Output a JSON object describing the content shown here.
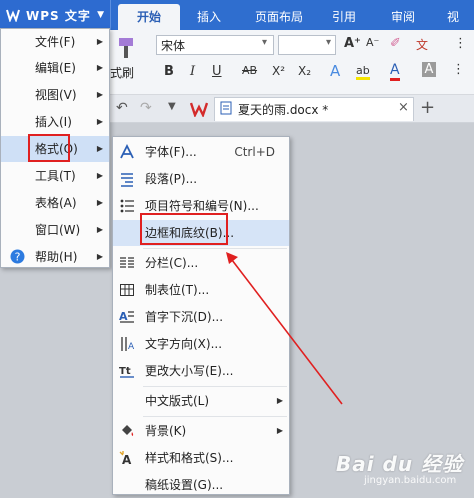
{
  "app": {
    "title": "WPS 文字",
    "ribbon_tabs": [
      "开始",
      "插入",
      "页面布局",
      "引用",
      "审阅",
      "视"
    ]
  },
  "ribbon": {
    "format_painter_label": "式刷",
    "font_name": "宋体",
    "buttons": {
      "bold": "B",
      "italic": "I",
      "underline": "U",
      "strikethrough": "AB",
      "superscript": "X²",
      "subscript": "X₂",
      "text_effect": "A",
      "highlight": "ab",
      "font_color": "A",
      "char_shading": "A",
      "grow_font": "A⁺",
      "shrink_font": "A⁻",
      "pinyin": "文"
    }
  },
  "document_tab": {
    "name": "夏天的雨.docx *",
    "close": "×",
    "add": "+"
  },
  "main_menu": {
    "items": [
      {
        "label": "文件(F)"
      },
      {
        "label": "编辑(E)"
      },
      {
        "label": "视图(V)"
      },
      {
        "label": "插入(I)"
      },
      {
        "label": "格式(O)"
      },
      {
        "label": "工具(T)"
      },
      {
        "label": "表格(A)"
      },
      {
        "label": "窗口(W)"
      },
      {
        "label": "帮助(H)"
      }
    ]
  },
  "format_menu": {
    "items": [
      {
        "label": "字体(F)...",
        "shortcut": "Ctrl+D",
        "icon": "font-A-icon"
      },
      {
        "label": "段落(P)...",
        "icon": "paragraph-icon"
      },
      {
        "label": "项目符号和编号(N)...",
        "icon": "bullet-list-icon"
      },
      {
        "label": "边框和底纹(B)...",
        "icon": ""
      },
      {
        "label": "分栏(C)...",
        "icon": "columns-icon"
      },
      {
        "label": "制表位(T)...",
        "icon": "tab-stop-icon"
      },
      {
        "label": "首字下沉(D)...",
        "icon": "drop-cap-icon"
      },
      {
        "label": "文字方向(X)...",
        "icon": "text-direction-icon"
      },
      {
        "label": "更改大小写(E)...",
        "icon": "change-case-icon"
      },
      {
        "label": "中文版式(L)",
        "icon": ""
      },
      {
        "label": "背景(K)",
        "icon": "paint-bucket-icon"
      },
      {
        "label": "样式和格式(S)...",
        "icon": "styles-icon"
      },
      {
        "label": "稿纸设置(G)...",
        "icon": ""
      }
    ]
  },
  "watermark": {
    "main": "Bai du 经验",
    "sub": "jingyan.baidu.com"
  },
  "colors": {
    "title_bar": "#2f6ecf",
    "highlight": "#d6e4f7",
    "annotation_red": "#e02020"
  }
}
